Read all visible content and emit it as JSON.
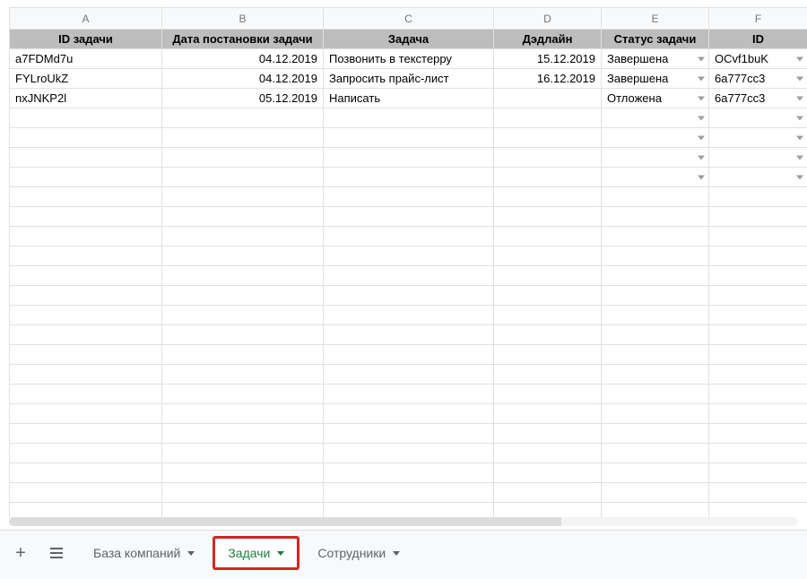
{
  "columns": [
    "A",
    "B",
    "C",
    "D",
    "E",
    "F"
  ],
  "headers": [
    "ID задачи",
    "Дата постановки задачи",
    "Задача",
    "Дэдлайн",
    "Статус задачи",
    "ID"
  ],
  "rows": [
    {
      "task_id": "a7FDMd7u",
      "date_set": "04.12.2019",
      "task": "Позвонить в текстерру",
      "deadline": "15.12.2019",
      "status": "Завершена",
      "id": "OCvf1buK"
    },
    {
      "task_id": "FYLroUkZ",
      "date_set": "04.12.2019",
      "task": "Запросить прайс-лист",
      "deadline": "16.12.2019",
      "status": "Завершена",
      "id": "6a777cc3"
    },
    {
      "task_id": "nxJNKP2l",
      "date_set": "05.12.2019",
      "task": "Написать",
      "deadline": "",
      "status": "Отложена",
      "id": "6a777cc3"
    }
  ],
  "empty_dropdown_rows": 4,
  "plain_empty_rows": 18,
  "tabs": {
    "items": [
      "База компаний",
      "Задачи",
      "Сотрудники"
    ],
    "active_index": 1
  }
}
